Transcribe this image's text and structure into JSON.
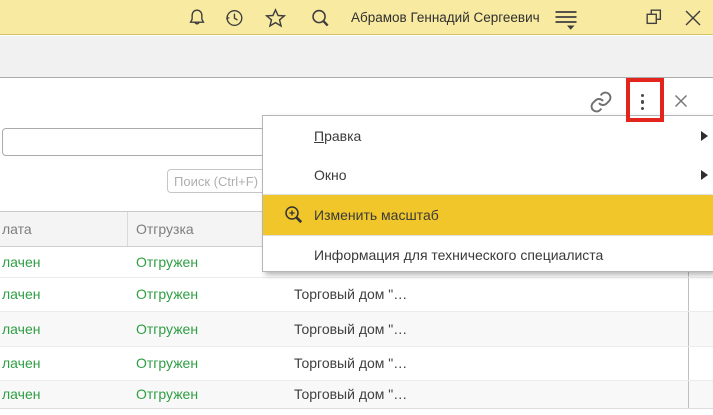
{
  "window": {
    "user_name": "Абрамов Геннадий Сергеевич",
    "titlebar_icons": [
      "notifications-bell",
      "history-clock",
      "favorites-star",
      "search-magnifier",
      "service-menu",
      "minimize",
      "restore",
      "close"
    ]
  },
  "form_header": {
    "icons": [
      "link",
      "more-kebab",
      "close"
    ],
    "annotation": "red-box-around-kebab-menu"
  },
  "search": {
    "placeholder": "Поиск (Ctrl+F)"
  },
  "menu": {
    "items": [
      {
        "label": "Правка",
        "accel": "П",
        "rest": "равка",
        "has_submenu": true,
        "highlighted": false
      },
      {
        "label": "Окно",
        "has_submenu": true,
        "highlighted": false
      },
      {
        "label": "Изменить масштаб",
        "icon": "zoom-in",
        "highlighted": true
      },
      {
        "label": "Информация для технического специалиста",
        "highlighted": false
      }
    ]
  },
  "table": {
    "columns": [
      "лата",
      "Отгрузка",
      "",
      ""
    ],
    "rows": [
      {
        "payment": "лачен",
        "shipment": "Отгружен",
        "customer": ""
      },
      {
        "payment": "лачен",
        "shipment": "Отгружен",
        "customer": "Торговый дом \"…"
      },
      {
        "payment": "лачен",
        "shipment": "Отгружен",
        "customer": "Торговый дом \"…"
      },
      {
        "payment": "лачен",
        "shipment": "Отгружен",
        "customer": "Торговый дом \"…"
      },
      {
        "payment": "лачен",
        "shipment": "Отгружен",
        "customer": "Торговый дом \"…"
      }
    ]
  },
  "colors": {
    "titlebar_yellow": "#F9EAA1",
    "menu_highlight_gold": "#F0C62A",
    "status_green": "#2E9E44",
    "annotation_red": "#E3241C",
    "header_gray_bg": "#F4F4F4"
  }
}
